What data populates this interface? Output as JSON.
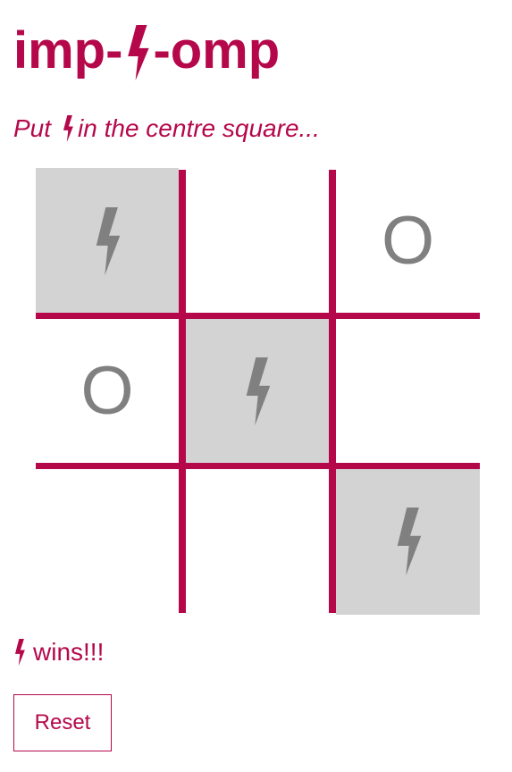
{
  "title": {
    "before": "imp-",
    "after": "-omp",
    "icon": "lightning-bolt-icon"
  },
  "instruction": {
    "before": "Put",
    "after": "in the centre square...",
    "icon": "lightning-bolt-icon"
  },
  "board": {
    "cells": [
      {
        "mark": "X",
        "win": true
      },
      {
        "mark": "",
        "win": false
      },
      {
        "mark": "O",
        "win": false
      },
      {
        "mark": "O",
        "win": false
      },
      {
        "mark": "X",
        "win": true
      },
      {
        "mark": "",
        "win": false
      },
      {
        "mark": "",
        "win": false
      },
      {
        "mark": "",
        "win": false
      },
      {
        "mark": "X",
        "win": true
      }
    ],
    "o_symbol": "O",
    "x_icon": "lightning-bolt-icon"
  },
  "status": {
    "text": "wins!!!",
    "icon": "lightning-bolt-icon"
  },
  "reset": {
    "label": "Reset"
  },
  "colors": {
    "accent": "#b5084a",
    "mark": "#808080",
    "win_highlight": "#d3d3d3",
    "background": "#ffffff"
  }
}
